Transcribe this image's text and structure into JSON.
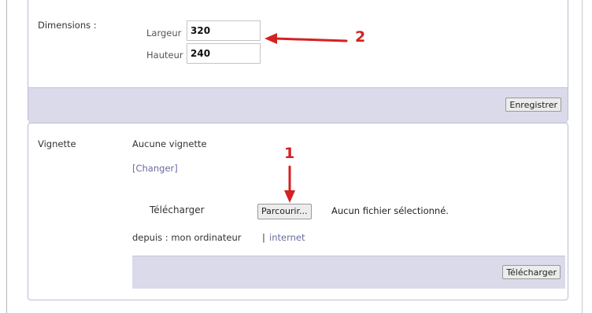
{
  "dimensions": {
    "label": "Dimensions :",
    "width_label": "Largeur",
    "width_value": "320",
    "height_label": "Hauteur",
    "height_value": "240",
    "save_button": "Enregistrer"
  },
  "thumbnail": {
    "label": "Vignette",
    "status": "Aucune vignette",
    "change_link": "[Changer]",
    "upload_label": "Télécharger",
    "browse_button": "Parcourir...",
    "no_file_text": "Aucun fichier sélectionné.",
    "source_prefix": "depuis : mon ordinateur",
    "separator": "|",
    "source_link": "internet",
    "upload_button": "Télécharger"
  },
  "annotations": {
    "marker_1": "1",
    "marker_2": "2",
    "color": "#d42121"
  }
}
